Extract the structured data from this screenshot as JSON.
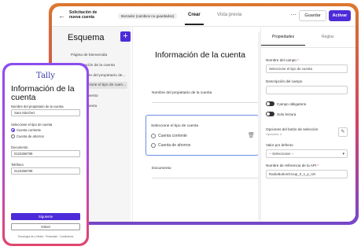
{
  "builder": {
    "back_icon": "arrow-left-icon",
    "form_title": "Solicitación de nueva cuenta",
    "draft_badge": "Borrador (cambios no guardados)",
    "tabs": {
      "create": "Crear",
      "preview": "Vista previa"
    },
    "more_icon": "ellipsis-icon",
    "save": "Guardar",
    "activate": "Activar",
    "accent_color": "#4d2bd9"
  },
  "schema": {
    "heading": "Esquema",
    "add_icon": "plus-icon",
    "items": [
      "Página de bienvenida",
      "Información de la cuenta",
      "Nombre del propietario de...",
      "Seleccione el tipo de cuen...",
      "Documento",
      "Agradecimiento"
    ]
  },
  "canvas": {
    "page_title": "Información de la cuenta",
    "owner_label": "Nombre del propietario de la cuenta",
    "select_label": "Seleccione el tipo de cuenta",
    "options": [
      "Cuenta corriente",
      "Cuenta de ahorros"
    ],
    "document_label": "Documento",
    "trash_icon": "trash-icon"
  },
  "properties": {
    "tabs": {
      "properties": "Propiedades",
      "rules": "Reglas"
    },
    "field_name_label": "Nombre del campo",
    "field_name_required": "*",
    "field_name_value": "Seleccione el tipo de cuenta",
    "description_label": "Descripción del campo",
    "description_value": "",
    "required_toggle": "Campo obligatorio",
    "readonly_toggle": "Solo lectura",
    "options_label": "Opciones del botón de selección",
    "options_count": "Opciones: 2",
    "default_label": "Valor por defecto",
    "default_value": "-- Seleccionar --",
    "api_label": "Nombre de referencia de la API",
    "api_required": "*",
    "api_value": "RadioButtonGroup_0_x_p_U8",
    "pencil_icon": "pencil-icon",
    "caret_icon": "chevron-down-icon"
  },
  "phone": {
    "logo": "Tally",
    "title": "Información de la cuenta",
    "owner_label": "Nombre del propietario de la cuenta",
    "owner_value": "Sara Sánchez",
    "select_label": "Seleccione el tipo de cuenta",
    "options": [
      "Cuenta corriente",
      "Cuenta de ahorros"
    ],
    "document_label": "Documento",
    "document_value": "0123456789",
    "phone_label": "Teléfono",
    "phone_value": "0123456789",
    "next": "Siguiente",
    "back": "Volver",
    "footer": "Tecnología de ● Nintex · Privacidad · Condiciones"
  }
}
